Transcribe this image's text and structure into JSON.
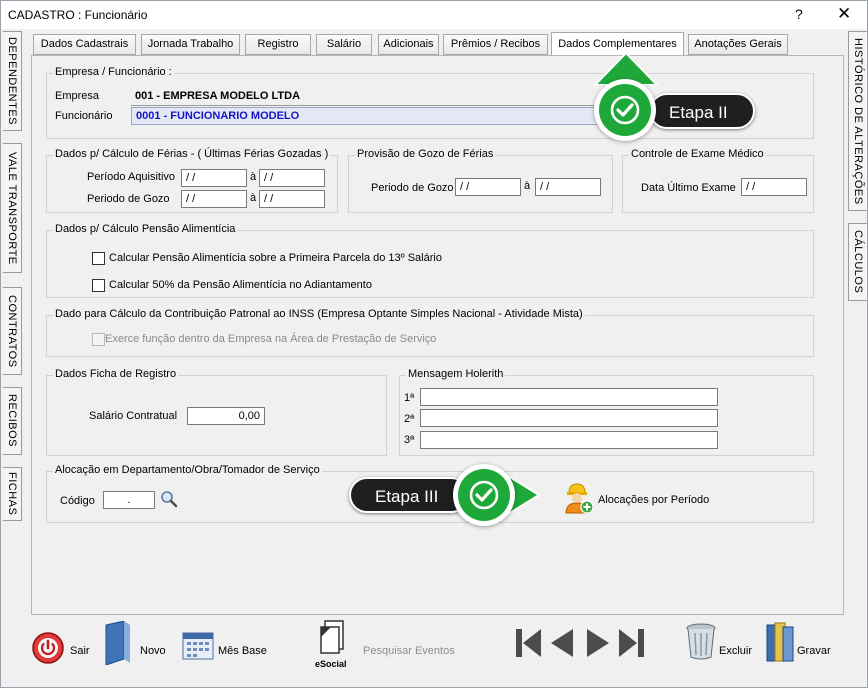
{
  "window": {
    "title": "CADASTRO : Funcionário",
    "help": "?",
    "close": "✕"
  },
  "left_tabs": [
    "DEPENDENTES",
    "VALE TRANSPORTE",
    "CONTRATOS",
    "RECIBOS",
    "FICHAS"
  ],
  "right_tabs": [
    "HISTÓRICO DE ALTERAÇÕES",
    "CÁLCULOS"
  ],
  "tabs": [
    {
      "label": "Dados Cadastrais"
    },
    {
      "label": "Jornada Trabalho"
    },
    {
      "label": "Registro"
    },
    {
      "label": "Salário"
    },
    {
      "label": "Adicionais"
    },
    {
      "label": "Prêmios / Recibos"
    },
    {
      "label": "Dados Complementares",
      "active": true
    },
    {
      "label": "Anotações Gerais"
    }
  ],
  "empresa_group": {
    "caption": "Empresa / Funcionário :",
    "empresa_label": "Empresa",
    "empresa_value": "001 - EMPRESA MODELO LTDA",
    "funcionario_label": "Funcionário",
    "funcionario_value": "0001 - FUNCIONARIO MODELO"
  },
  "ferias_group": {
    "caption": "Dados p/ Cálculo de Férias - ( Últimas Férias Gozadas )",
    "aquisitivo_label": "Período Aquisitivo",
    "gozo_label": "Periodo de Gozo",
    "sep": "à",
    "date_placeholder": " / /"
  },
  "provisao_group": {
    "caption": "Provisão de Gozo de Férias",
    "gozo_label": "Periodo de Gozo",
    "sep": "à",
    "date_placeholder": " / /"
  },
  "exame_group": {
    "caption": "Controle de Exame Médico",
    "label": "Data Último Exame",
    "date_placeholder": " / /"
  },
  "pensao_group": {
    "caption": "Dados p/ Cálculo Pensão Alimentícia",
    "opt1": "Calcular Pensão Alimentícia sobre a Primeira Parcela do 13º Salário",
    "opt2": "Calcular 50% da Pensão Alimentícia no Adiantamento"
  },
  "inss_group": {
    "caption": "Dado para Cálculo da Contribuição Patronal ao INSS (Empresa Optante Simples Nacional - Atividade Mista)",
    "opt": "Exerce função dentro da Empresa na Área de Prestação de Serviço"
  },
  "ficha_group": {
    "caption": "Dados Ficha de Registro",
    "salario_label": "Salário Contratual",
    "salario_value": "0,00"
  },
  "holerith_group": {
    "caption": "Mensagem Holerith",
    "lines": [
      "1ª",
      "2ª",
      "3ª"
    ]
  },
  "alocacao_group": {
    "caption": "Alocação em Departamento/Obra/Tomador de Serviço",
    "codigo_label": "Código",
    "codigo_value": ".",
    "periodo_label": "Alocações por Período"
  },
  "annotations": {
    "etapa2": "Etapa II",
    "etapa3": "Etapa III"
  },
  "toolbar": {
    "sair": "Sair",
    "novo": "Novo",
    "mes_base": "Mês Base",
    "pesquisar": "Pesquisar Eventos",
    "esocial": "eSocial",
    "excluir": "Excluir",
    "gravar": "Gravar"
  },
  "colors": {
    "accent_green": "#1fa83a",
    "funcionario_blue": "#1515c8"
  }
}
